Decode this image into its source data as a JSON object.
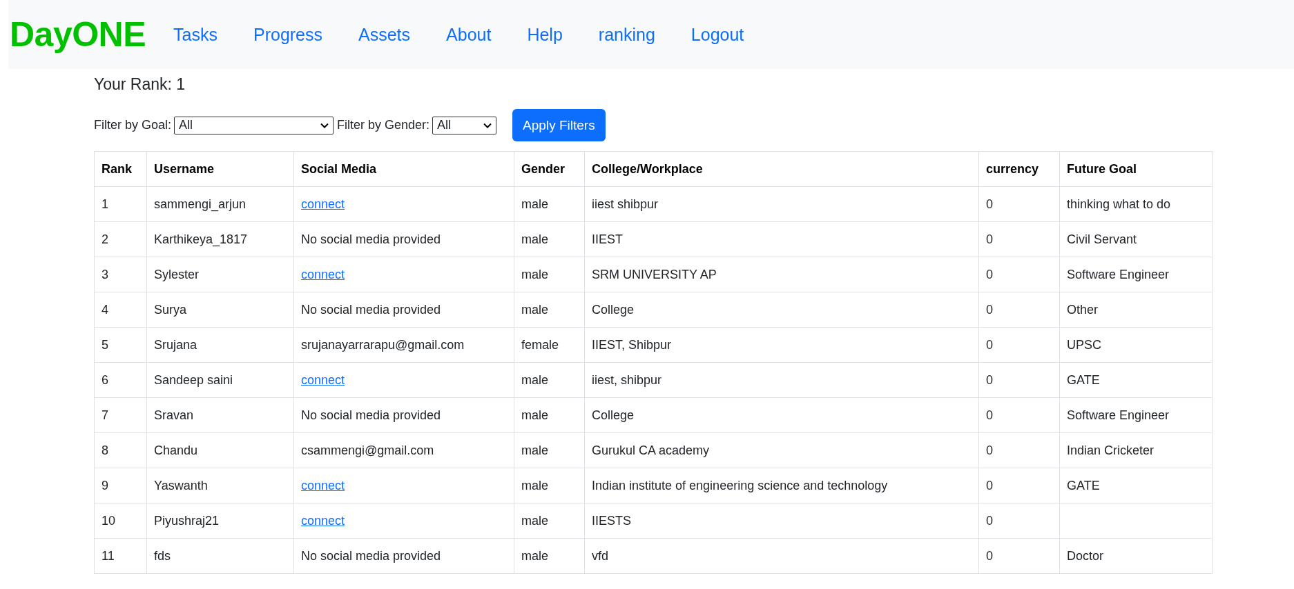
{
  "nav": {
    "logo": "DayONE",
    "links": [
      "Tasks",
      "Progress",
      "Assets",
      "About",
      "Help",
      "ranking",
      "Logout"
    ]
  },
  "rank_heading": "Your Rank: 1",
  "filters": [
    {
      "label": "Filter by Goal:",
      "value": "All",
      "kind": "wide"
    },
    {
      "label": "Filter by Gender:",
      "value": "All",
      "kind": "narrow"
    }
  ],
  "apply_button": "Apply Filters",
  "table": {
    "columns": [
      "Rank",
      "Username",
      "Social Media",
      "Gender",
      "College/Workplace",
      "currency",
      "Future Goal"
    ],
    "rows": [
      {
        "rank": "1",
        "username": "sammengi_arjun",
        "social": {
          "kind": "link",
          "text": "connect"
        },
        "gender": "male",
        "college": "iiest shibpur",
        "currency": "0",
        "goal": "thinking what to do"
      },
      {
        "rank": "2",
        "username": "Karthikeya_1817",
        "social": {
          "kind": "text",
          "text": "No social media provided"
        },
        "gender": "male",
        "college": "IIEST",
        "currency": "0",
        "goal": "Civil Servant"
      },
      {
        "rank": "3",
        "username": "Sylester",
        "social": {
          "kind": "link",
          "text": "connect"
        },
        "gender": "male",
        "college": "SRM UNIVERSITY AP",
        "currency": "0",
        "goal": "Software Engineer"
      },
      {
        "rank": "4",
        "username": "Surya",
        "social": {
          "kind": "text",
          "text": "No social media provided"
        },
        "gender": "male",
        "college": "College",
        "currency": "0",
        "goal": "Other"
      },
      {
        "rank": "5",
        "username": "Srujana",
        "social": {
          "kind": "text",
          "text": "srujanayarrarapu@gmail.com"
        },
        "gender": "female",
        "college": "IIEST, Shibpur",
        "currency": "0",
        "goal": "UPSC"
      },
      {
        "rank": "6",
        "username": "Sandeep saini",
        "social": {
          "kind": "link",
          "text": "connect"
        },
        "gender": "male",
        "college": "iiest, shibpur",
        "currency": "0",
        "goal": "GATE"
      },
      {
        "rank": "7",
        "username": "Sravan",
        "social": {
          "kind": "text",
          "text": "No social media provided"
        },
        "gender": "male",
        "college": "College",
        "currency": "0",
        "goal": "Software Engineer"
      },
      {
        "rank": "8",
        "username": "Chandu",
        "social": {
          "kind": "text",
          "text": "csammengi@gmail.com"
        },
        "gender": "male",
        "college": "Gurukul CA academy",
        "currency": "0",
        "goal": "Indian Cricketer"
      },
      {
        "rank": "9",
        "username": "Yaswanth",
        "social": {
          "kind": "link",
          "text": "connect"
        },
        "gender": "male",
        "college": "Indian institute of engineering science and technology",
        "currency": "0",
        "goal": "GATE"
      },
      {
        "rank": "10",
        "username": "Piyushraj21",
        "social": {
          "kind": "link",
          "text": "connect"
        },
        "gender": "male",
        "college": "IIESTS",
        "currency": "0",
        "goal": ""
      },
      {
        "rank": "11",
        "username": "fds",
        "social": {
          "kind": "text",
          "text": "No social media provided"
        },
        "gender": "male",
        "college": "vfd",
        "currency": "0",
        "goal": "Doctor"
      }
    ]
  }
}
